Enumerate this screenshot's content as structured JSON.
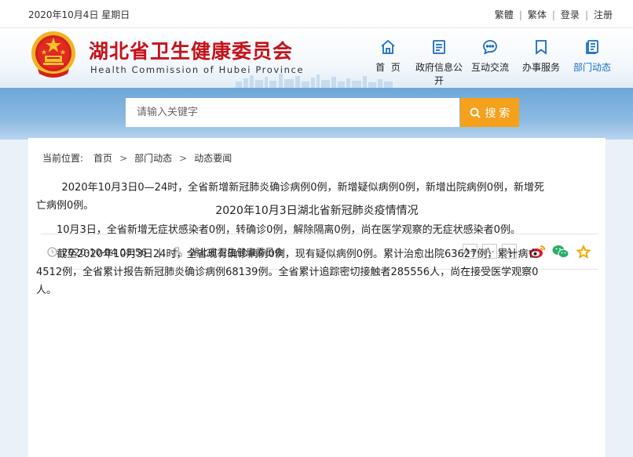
{
  "topbar": {
    "date": "2020年10月4日 星期日",
    "links": [
      "繁體",
      "繁体",
      "登录",
      "注册"
    ]
  },
  "header": {
    "title": "湖北省卫生健康委员会",
    "subtitle": "Health Commission of Hubei Province"
  },
  "nav": [
    {
      "label": "首  页",
      "icon": "home-icon"
    },
    {
      "label": "政府信息公开",
      "icon": "document-icon"
    },
    {
      "label": "互动交流",
      "icon": "chat-bubble-icon"
    },
    {
      "label": "办事服务",
      "icon": "bookmark-icon"
    },
    {
      "label": "部门动态",
      "icon": "news-icon",
      "active": true
    }
  ],
  "search": {
    "placeholder": "请输入关键字",
    "button_label": "搜 索"
  },
  "breadcrumb": {
    "prefix": "当前位置:",
    "items": [
      "首页",
      "部门动态",
      "动态要闻"
    ]
  },
  "article": {
    "title": "2020年10月3日湖北省新冠肺炎疫情情况",
    "datetime": "2020-10-04 08:56",
    "source": "湖北省卫生健康委员会",
    "font_buttons": [
      "A+",
      "A-",
      "A"
    ],
    "paragraphs": [
      "2020年10月3日0—24时，全省新增新冠肺炎确诊病例0例，新增疑似病例0例，新增出院病例0例，新增死亡病例0例。",
      "10月3日，全省新增无症状感染者0例，转确诊0例，解除隔离0例，尚在医学观察的无症状感染者0例。",
      "截至2020年10月3日24时，全省现有确诊病例0例，现有疑似病例0例。累计治愈出院63627例，累计病亡4512例，全省累计报告新冠肺炎确诊病例68139例。全省累计追踪密切接触者285556人，尚在接受医学观察0人。"
    ]
  },
  "colors": {
    "title_red": "#c6121a",
    "nav_active": "#1a6ec1",
    "search_button": "#f5a11b",
    "band_blue": "#6da7d8"
  }
}
